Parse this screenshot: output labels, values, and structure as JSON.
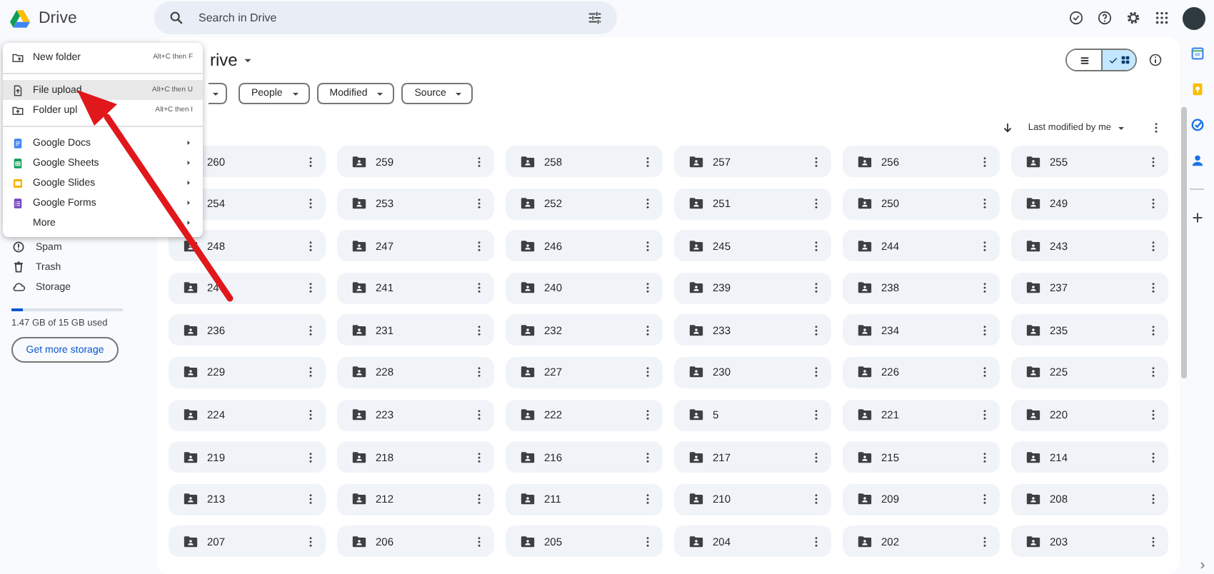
{
  "app": {
    "name": "Drive"
  },
  "search": {
    "placeholder": "Search in Drive"
  },
  "title": "rive",
  "filters": [
    {
      "label": "People"
    },
    {
      "label": "Modified"
    },
    {
      "label": "Source"
    }
  ],
  "view_toggle": [
    {
      "kind": "list",
      "selected": false
    },
    {
      "kind": "grid",
      "selected": true
    }
  ],
  "sort": {
    "label": "Last modified by me"
  },
  "sidebar": {
    "items": [
      {
        "label": "Spam"
      },
      {
        "label": "Trash"
      },
      {
        "label": "Storage"
      }
    ],
    "storage": {
      "level": 0.1,
      "text": "1.47 GB of 15 GB used",
      "button": "Get more storage"
    }
  },
  "menu": {
    "groups": [
      [
        {
          "kind": "action",
          "label": "New folder",
          "shortcut": "Alt+C then F",
          "selected": false
        }
      ],
      [
        {
          "kind": "action",
          "label": "File upload",
          "shortcut": "Alt+C then U",
          "selected": true
        },
        {
          "kind": "action",
          "label": "Folder upl",
          "shortcut": "Alt+C then I",
          "selected": false
        }
      ],
      [
        {
          "kind": "submenu",
          "label": "Google Docs",
          "selected": false
        },
        {
          "kind": "submenu",
          "label": "Google Sheets",
          "selected": false
        },
        {
          "kind": "submenu",
          "label": "Google Slides",
          "selected": false
        },
        {
          "kind": "submenu",
          "label": "Google Forms",
          "selected": false
        },
        {
          "kind": "submenu",
          "label": "More",
          "selected": false
        }
      ]
    ]
  },
  "folders": [
    "260",
    "259",
    "258",
    "257",
    "256",
    "255",
    "254",
    "253",
    "252",
    "251",
    "250",
    "249",
    "248",
    "247",
    "246",
    "245",
    "244",
    "243",
    "24",
    "241",
    "240",
    "239",
    "238",
    "237",
    "236",
    "231",
    "232",
    "233",
    "234",
    "235",
    "229",
    "228",
    "227",
    "230",
    "226",
    "225",
    "224",
    "223",
    "222",
    "5",
    "221",
    "220",
    "219",
    "218",
    "216",
    "217",
    "215",
    "214",
    "213",
    "212",
    "211",
    "210",
    "209",
    "208",
    "207",
    "206",
    "205",
    "204",
    "202",
    "203"
  ]
}
